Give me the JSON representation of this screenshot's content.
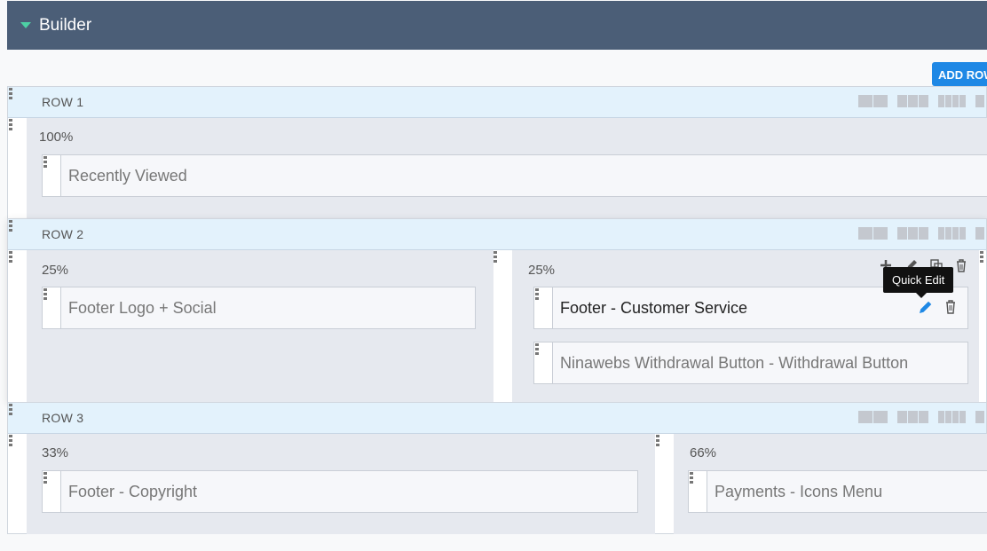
{
  "header": {
    "title": "Builder"
  },
  "toolbar": {
    "add_row_label": "ADD ROW"
  },
  "rows": [
    {
      "label": "ROW 1",
      "columns": [
        {
          "width": "100%",
          "modules": [
            "Recently Viewed"
          ]
        }
      ]
    },
    {
      "label": "ROW 2",
      "columns": [
        {
          "width": "25%",
          "modules": [
            "Footer Logo + Social"
          ]
        },
        {
          "width": "25%",
          "modules": [
            "Footer - Customer Service",
            "Ninawebs Withdrawal Button - Withdrawal Button"
          ]
        }
      ]
    },
    {
      "label": "ROW 3",
      "columns": [
        {
          "width": "33%",
          "modules": [
            "Footer - Copyright"
          ]
        },
        {
          "width": "66%",
          "modules": [
            "Payments - Icons Menu"
          ]
        }
      ]
    }
  ],
  "tooltip": {
    "text": "Quick Edit"
  },
  "icons": {
    "header_toggle": "caret-down-icon",
    "drag": "drag-handle-icon",
    "column_tools": [
      "plus-icon",
      "pencil-icon",
      "copy-icon",
      "trash-icon"
    ],
    "module_tools": [
      "pencil-icon",
      "trash-icon"
    ]
  },
  "colors": {
    "header_bg": "#4b5e77",
    "accent": "#1e88e5",
    "caret": "#4dd0a4",
    "row_header_bg": "#e3f2fc"
  }
}
